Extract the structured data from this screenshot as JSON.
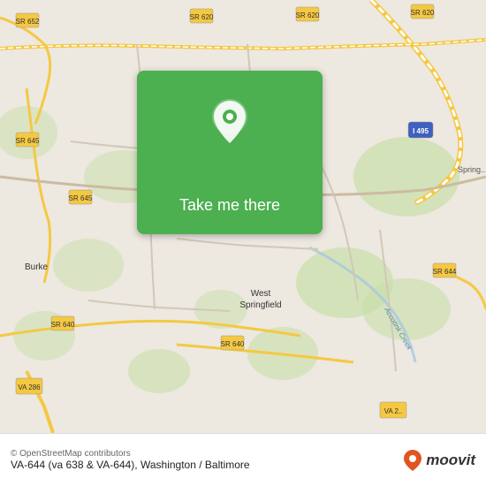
{
  "map": {
    "background_color": "#e8e0d8",
    "center_lat": 38.77,
    "center_lng": -77.22
  },
  "card": {
    "button_label": "Take me there",
    "background_color": "#4caf50"
  },
  "bottom_bar": {
    "credit": "© OpenStreetMap contributors",
    "title": "VA-644 (va 638 & VA-644), Washington / Baltimore",
    "logo_text": "moovit"
  },
  "road_labels": {
    "sr652": "SR 652",
    "sr620_left": "SR 620",
    "sr620_mid": "SR 620",
    "sr620_right": "SR 620",
    "sr645_left": "SR 645",
    "sr645_right": "SR 645",
    "sr644": "SR 644",
    "sr640_left": "SR 640",
    "sr640_right": "SR 640",
    "i495": "I 495",
    "va286": "VA 286",
    "va_bottom": "VA 2..."
  },
  "place_labels": {
    "burke": "Burke",
    "west_springfield": "West\nSpringfield",
    "springfield": "Spring...",
    "accotink_creek": "Accotink Creek"
  }
}
